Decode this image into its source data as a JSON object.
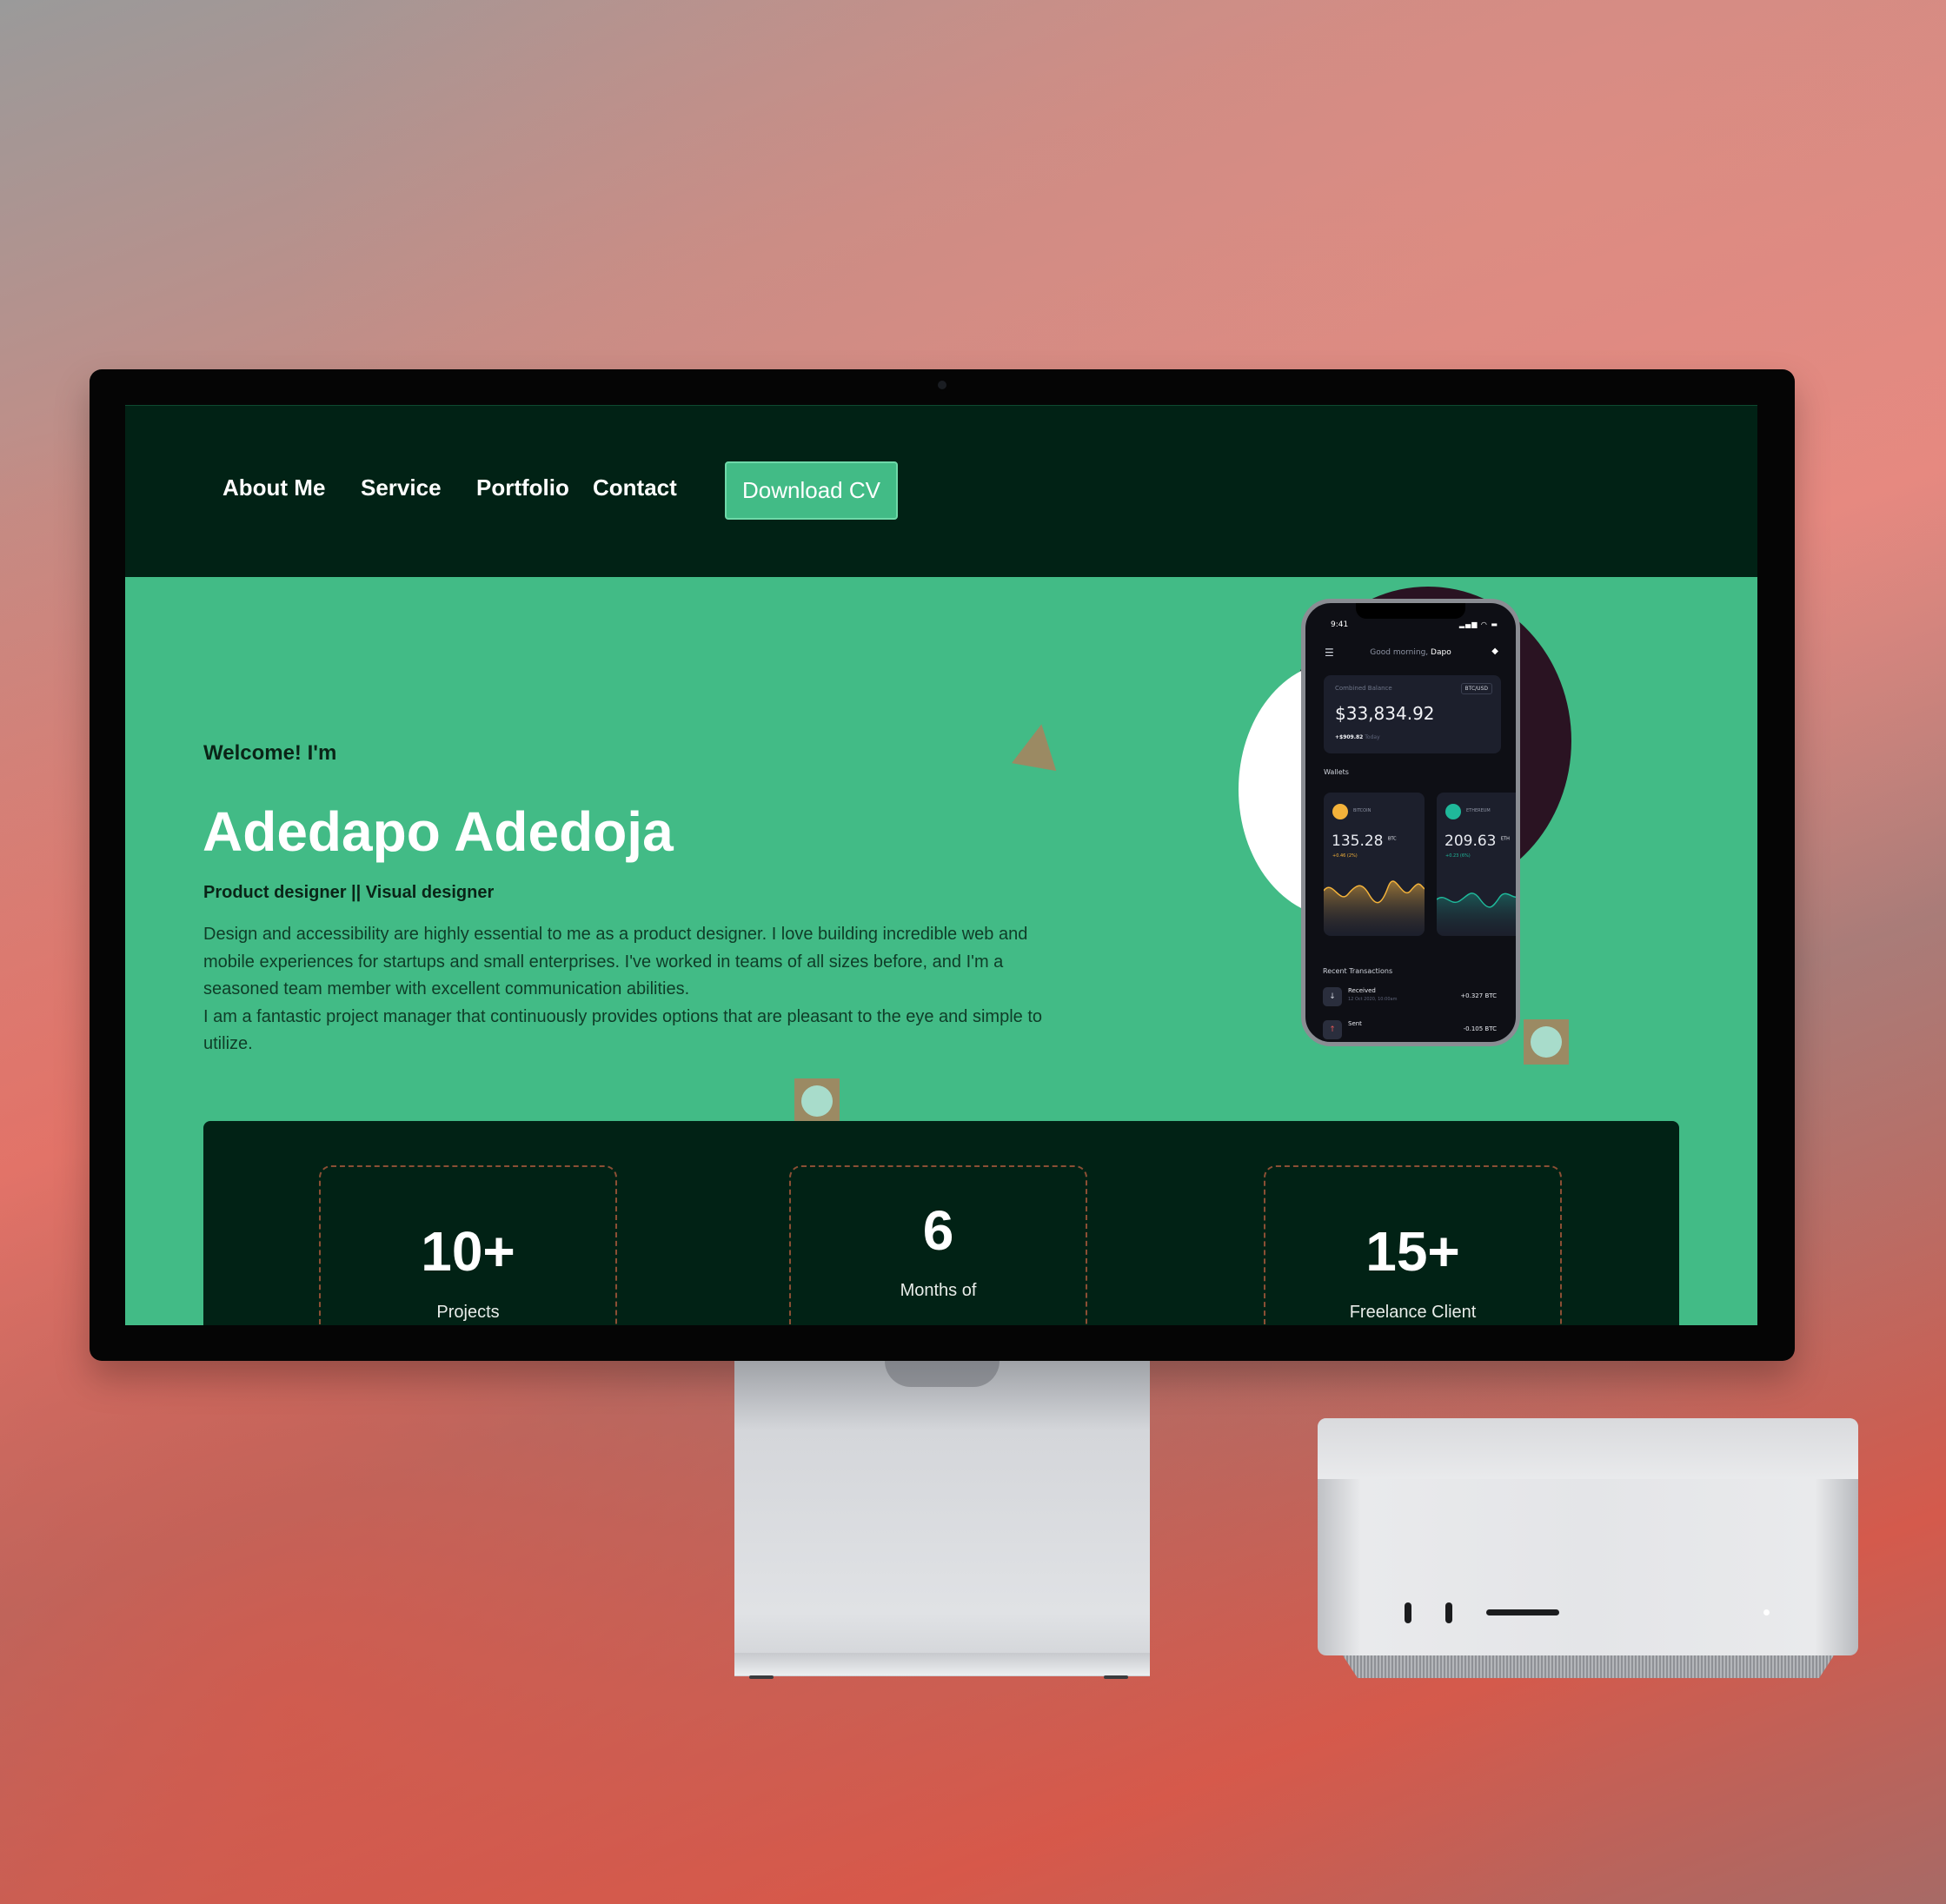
{
  "nav": {
    "links": [
      "About Me",
      "Service",
      "Portfolio",
      "Contact"
    ],
    "cta_label": "Download CV"
  },
  "hero": {
    "greeting": "Welcome! I'm",
    "name": "Adedapo Adedoja",
    "role": "Product designer || Visual designer",
    "bio": [
      "Design and accessibility are highly essential to me as a product designer. I love building incredible web and mobile experiences for startups and small enterprises. I've worked in teams of all sizes before, and I'm a seasoned team member with excellent communication abilities.",
      "I am a fantastic project manager that continuously provides options that are pleasant to the eye and simple to utilize."
    ]
  },
  "phone": {
    "time": "9:41",
    "greeting": "Good morning,",
    "user": "Dapo",
    "balance_label": "Combined Balance",
    "pair": "BTC/USD",
    "balance": "$33,834.92",
    "balance_change": "+$909.82",
    "balance_change_period": "Today",
    "wallets_label": "Wallets",
    "wallets": [
      {
        "coin": "BITCOIN",
        "amount": "135.28",
        "unit": "BTC",
        "change": "+0.46 (2%)"
      },
      {
        "coin": "ETHEREUM",
        "amount": "209.63",
        "unit": "ETH",
        "change": "+0.23 (6%)"
      }
    ],
    "recent_label": "Recent Transactions",
    "transactions": [
      {
        "label": "Received",
        "date": "12 Oct 2020, 10:00am",
        "amount": "+0.327 BTC"
      },
      {
        "label": "Sent",
        "date": "",
        "amount": "-0.105 BTC"
      }
    ]
  },
  "stats": [
    {
      "value": "10+",
      "label": "Projects"
    },
    {
      "value": "6",
      "label": "Months of"
    },
    {
      "value": "15+",
      "label": "Freelance Client"
    }
  ],
  "colors": {
    "nav_bg": "#012215",
    "hero_bg": "#42bb86",
    "accent_border": "#6fd9a9",
    "deco_tan": "#9b8a63",
    "stat_border": "#8b4f34"
  }
}
